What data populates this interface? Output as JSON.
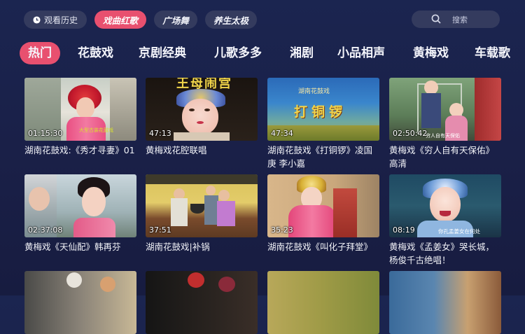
{
  "topbar": {
    "history_label": "观看历史",
    "tabs": [
      "戏曲红歌",
      "广场舞",
      "养生太极"
    ],
    "search_placeholder": "搜索"
  },
  "categories": [
    "热门",
    "花鼓戏",
    "京剧经典",
    "儿歌多多",
    "湘剧",
    "小品相声",
    "黄梅戏",
    "车载歌"
  ],
  "videos": [
    {
      "duration": "01:15:30",
      "title": "湖南花鼓戏:《秀才寻妻》01"
    },
    {
      "duration": "47:13",
      "title": "黄梅戏花腔联唱"
    },
    {
      "duration": "47:34",
      "title": "湖南花鼓戏《打铜锣》凌国庚 李小嘉"
    },
    {
      "duration": "02:50:42",
      "title": "黄梅戏《穷人自有天保佑》高清"
    },
    {
      "duration": "02:37:08",
      "title": "黄梅戏《天仙配》韩再芬"
    },
    {
      "duration": "37:51",
      "title": "湖南花鼓戏|补锅"
    },
    {
      "duration": "35:23",
      "title": "湖南花鼓戏《叫化子拜堂》"
    },
    {
      "duration": "08:19",
      "title": "黄梅戏《孟姜女》哭长城，杨俊千古绝唱！"
    }
  ],
  "thumb_text": {
    "t1_sub": "大型古装花鼓戏",
    "t2_top": "王母闹宫",
    "t3_top": "湖南花鼓戏",
    "t3_main": "打铜锣",
    "t4_sub": "穷人自有天保佑",
    "t8_sub": "你孔孟姜女在何处"
  },
  "colors": {
    "accent": "#e8506f",
    "pill": "#343b5e"
  }
}
